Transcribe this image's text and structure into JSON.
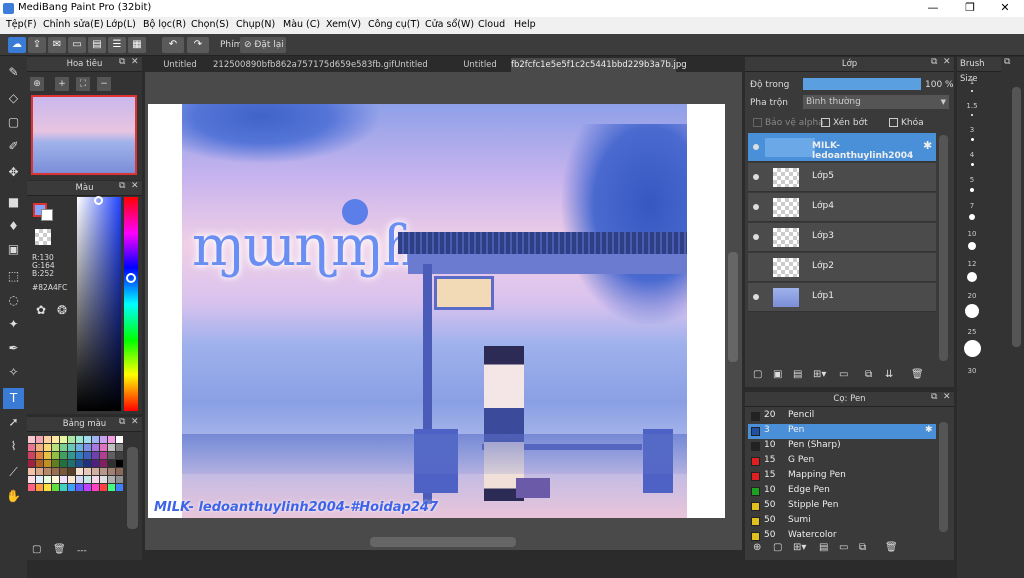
{
  "app": {
    "title": "MediBang Paint Pro (32bit)"
  },
  "window": {
    "minimize": "—",
    "maximize": "❐",
    "close": "✕"
  },
  "menu": [
    "Tệp(F)",
    "Chỉnh sửa(E)",
    "Lớp(L)",
    "Bộ lọc(R)",
    "Chọn(S)",
    "Chụp(N)",
    "Màu (C)",
    "Xem(V)",
    "Công cụ(T)",
    "Cửa sổ(W)",
    "Cloud",
    "Help"
  ],
  "toolbar": {
    "phim_label": "Phím",
    "reset_label": "Đặt lại"
  },
  "tabs": [
    "Untitled",
    "212500890bfb862a757175d659e583fb.gif",
    "Untitled",
    "Untitled",
    "fb2fcfc1e5e5f1c2c5441bbd229b3a7b.jpg"
  ],
  "navigator": {
    "title": "Hoa tiêu"
  },
  "color": {
    "title": "Màu",
    "r": "R:130",
    "g": "G:164",
    "b": "B:252",
    "hex": "#82A4FC",
    "current": "#82A4FC"
  },
  "palette": {
    "title": "Bảng màu",
    "footer": "---",
    "colors": [
      "#f8c8d0",
      "#f4a6b4",
      "#ffd0a0",
      "#ffe9a0",
      "#e6f7a0",
      "#a9e6a0",
      "#9fe6d0",
      "#a0dcf0",
      "#a0b4f4",
      "#c8a0f4",
      "#f0a0e0",
      "#ffffff",
      "#e87890",
      "#f0b080",
      "#f8d878",
      "#b8e078",
      "#78d090",
      "#68c8b8",
      "#70b0e0",
      "#8090e8",
      "#a878e0",
      "#e070c0",
      "#c0c0c0",
      "#808080",
      "#d04060",
      "#e08040",
      "#e8c040",
      "#90c040",
      "#40a060",
      "#309890",
      "#3080c0",
      "#4060c0",
      "#7040b0",
      "#b04090",
      "#606060",
      "#404040",
      "#a02040",
      "#b06020",
      "#c09020",
      "#608020",
      "#207040",
      "#207070",
      "#205090",
      "#203080",
      "#502080",
      "#802060",
      "#303030",
      "#000000",
      "#f4c0a8",
      "#d8a888",
      "#b88868",
      "#987050",
      "#785838",
      "#584028",
      "#f8e0d0",
      "#e8c8b8",
      "#d0b0a0",
      "#b89888",
      "#a08070",
      "#886858",
      "#ffe0e8",
      "#e0f0ff",
      "#e8ffe0",
      "#fff8d8",
      "#f0e0ff",
      "#ffe8d0",
      "#d8d8f8",
      "#c8e8e8",
      "#f8d8e8",
      "#e0e0e0",
      "#b0b0b0",
      "#909090",
      "#ff6080",
      "#ffa040",
      "#ffe040",
      "#60e040",
      "#40d0c0",
      "#40a0ff",
      "#6060ff",
      "#c040ff",
      "#ff40c0",
      "#ff4040",
      "#40ff80",
      "#4080ff"
    ]
  },
  "canvas": {
    "watermark": "MILK-  ledoanthuylinh2004-#Hoidap247",
    "art_text": "ɱɯɳɱɦ"
  },
  "layers": {
    "title": "Lớp",
    "opacity_label": "Độ trong",
    "opacity_value": "100 %",
    "opacity_pct": 100,
    "blend_label": "Pha trộn",
    "blend_value": "Bình thường",
    "protect_alpha": "Bảo vệ alpha",
    "clip": "Xén bớt",
    "lock": "Khóa",
    "items": [
      "MILK- ledoanthuylinh2004",
      "Lớp5",
      "Lớp4",
      "Lớp3",
      "Lớp2",
      "Lớp1"
    ]
  },
  "brush": {
    "title": "Cọ: Pen",
    "items": [
      {
        "size": "20",
        "name": "Pencil",
        "color": "#222222"
      },
      {
        "size": "3",
        "name": "Pen",
        "color": "#2050a0"
      },
      {
        "size": "10",
        "name": "Pen (Sharp)",
        "color": "#222222"
      },
      {
        "size": "15",
        "name": "G Pen",
        "color": "#e02020"
      },
      {
        "size": "15",
        "name": "Mapping Pen",
        "color": "#e02020"
      },
      {
        "size": "10",
        "name": "Edge Pen",
        "color": "#20a020"
      },
      {
        "size": "50",
        "name": "Stipple Pen",
        "color": "#e0c020"
      },
      {
        "size": "50",
        "name": "Sumi",
        "color": "#e0c020"
      },
      {
        "size": "50",
        "name": "Watercolor",
        "color": "#e0c020"
      }
    ]
  },
  "brushsize": {
    "title": "Brush Size",
    "sizes": [
      "1",
      "·",
      "1.5",
      "·",
      "3",
      "·",
      "4",
      "·",
      "5",
      "·",
      "7",
      "·",
      "10",
      "·",
      "12",
      "·",
      "20",
      "·",
      "25",
      "·",
      "30"
    ]
  }
}
